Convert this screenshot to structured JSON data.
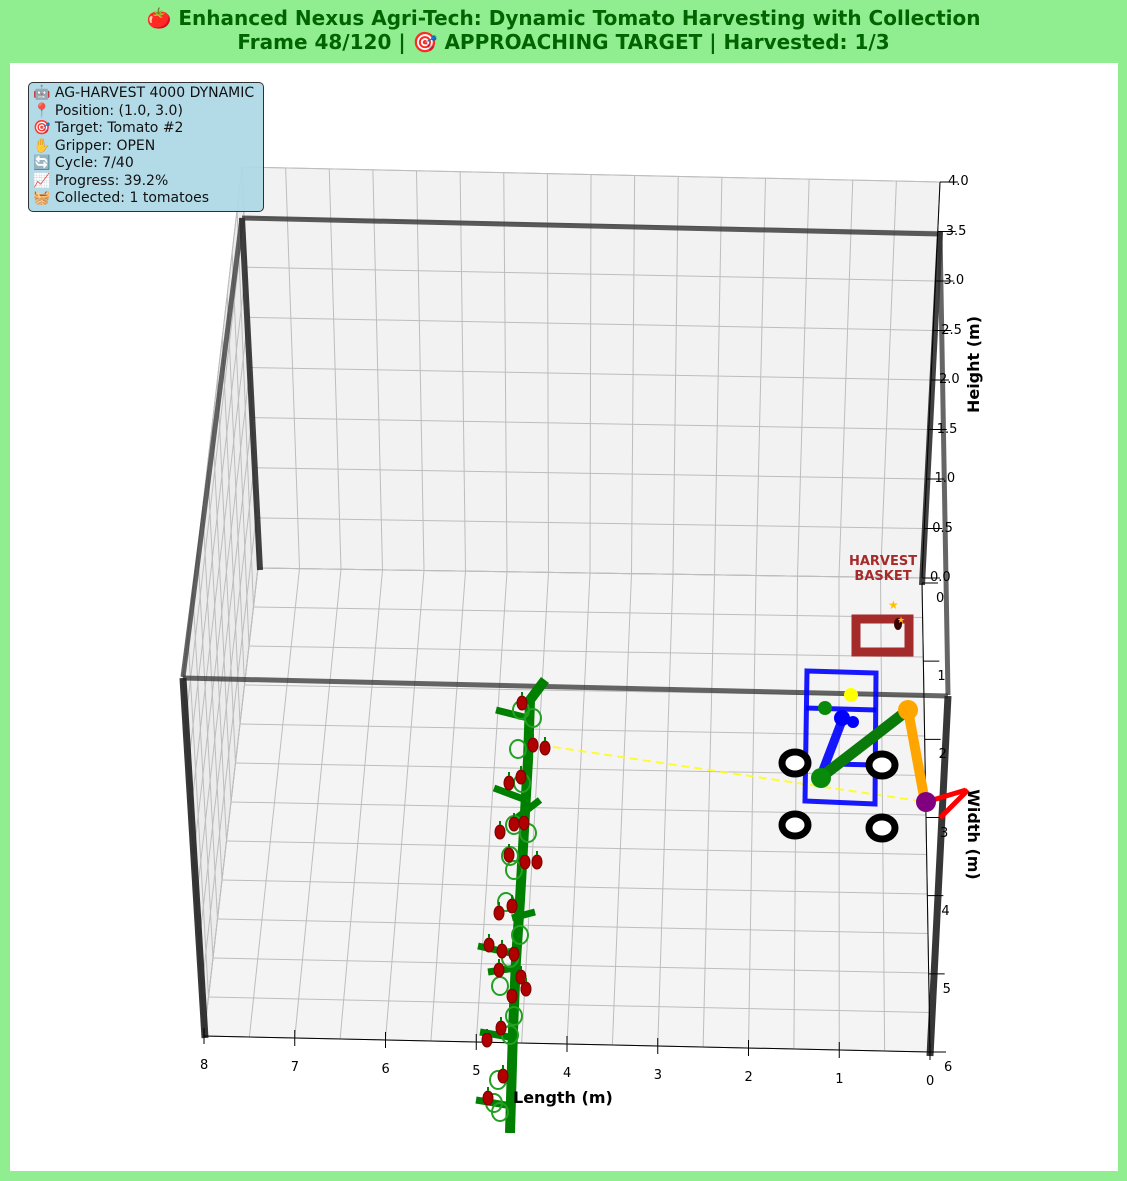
{
  "header": {
    "line1": "🍅 Enhanced Nexus Agri-Tech: Dynamic Tomato Harvesting with Collection",
    "line2": "Frame 48/120 | 🎯 APPROACHING TARGET | Harvested: 1/3"
  },
  "status_panel": {
    "model": "🤖 AG-HARVEST 4000 DYNAMIC",
    "position": "📍 Position: (1.0, 3.0)",
    "target": "🎯 Target: Tomato #2",
    "gripper": "✋ Gripper: OPEN",
    "cycle": "🔄 Cycle: 7/40",
    "progress": "📈 Progress: 39.2%",
    "collected": "🧺 Collected: 1 tomatoes"
  },
  "axes": {
    "x_label": "Length (m)",
    "y_label": "Width (m)",
    "z_label": "Height (m)",
    "x_ticks": [
      "8",
      "7",
      "6",
      "5",
      "4",
      "3",
      "2",
      "1",
      "0"
    ],
    "y_ticks": [
      "0",
      "1",
      "2",
      "3",
      "4",
      "5",
      "6"
    ],
    "z_ticks": [
      "0.0",
      "0.5",
      "1.0",
      "1.5",
      "2.0",
      "2.5",
      "3.0",
      "3.5",
      "4.0"
    ]
  },
  "scene": {
    "basket_label": "HARVEST\nBASKET",
    "colors": {
      "plant": "#008000",
      "tomato": "#b00000",
      "robot_frame": "#0000ff",
      "arm_upper": "#ffa500",
      "arm_lower": "#0a7a0a",
      "gripper": "#800080",
      "end_effector": "#ff0000",
      "basket": "#a52a2a",
      "path": "#ffff00",
      "wheels": "#000000"
    }
  }
}
